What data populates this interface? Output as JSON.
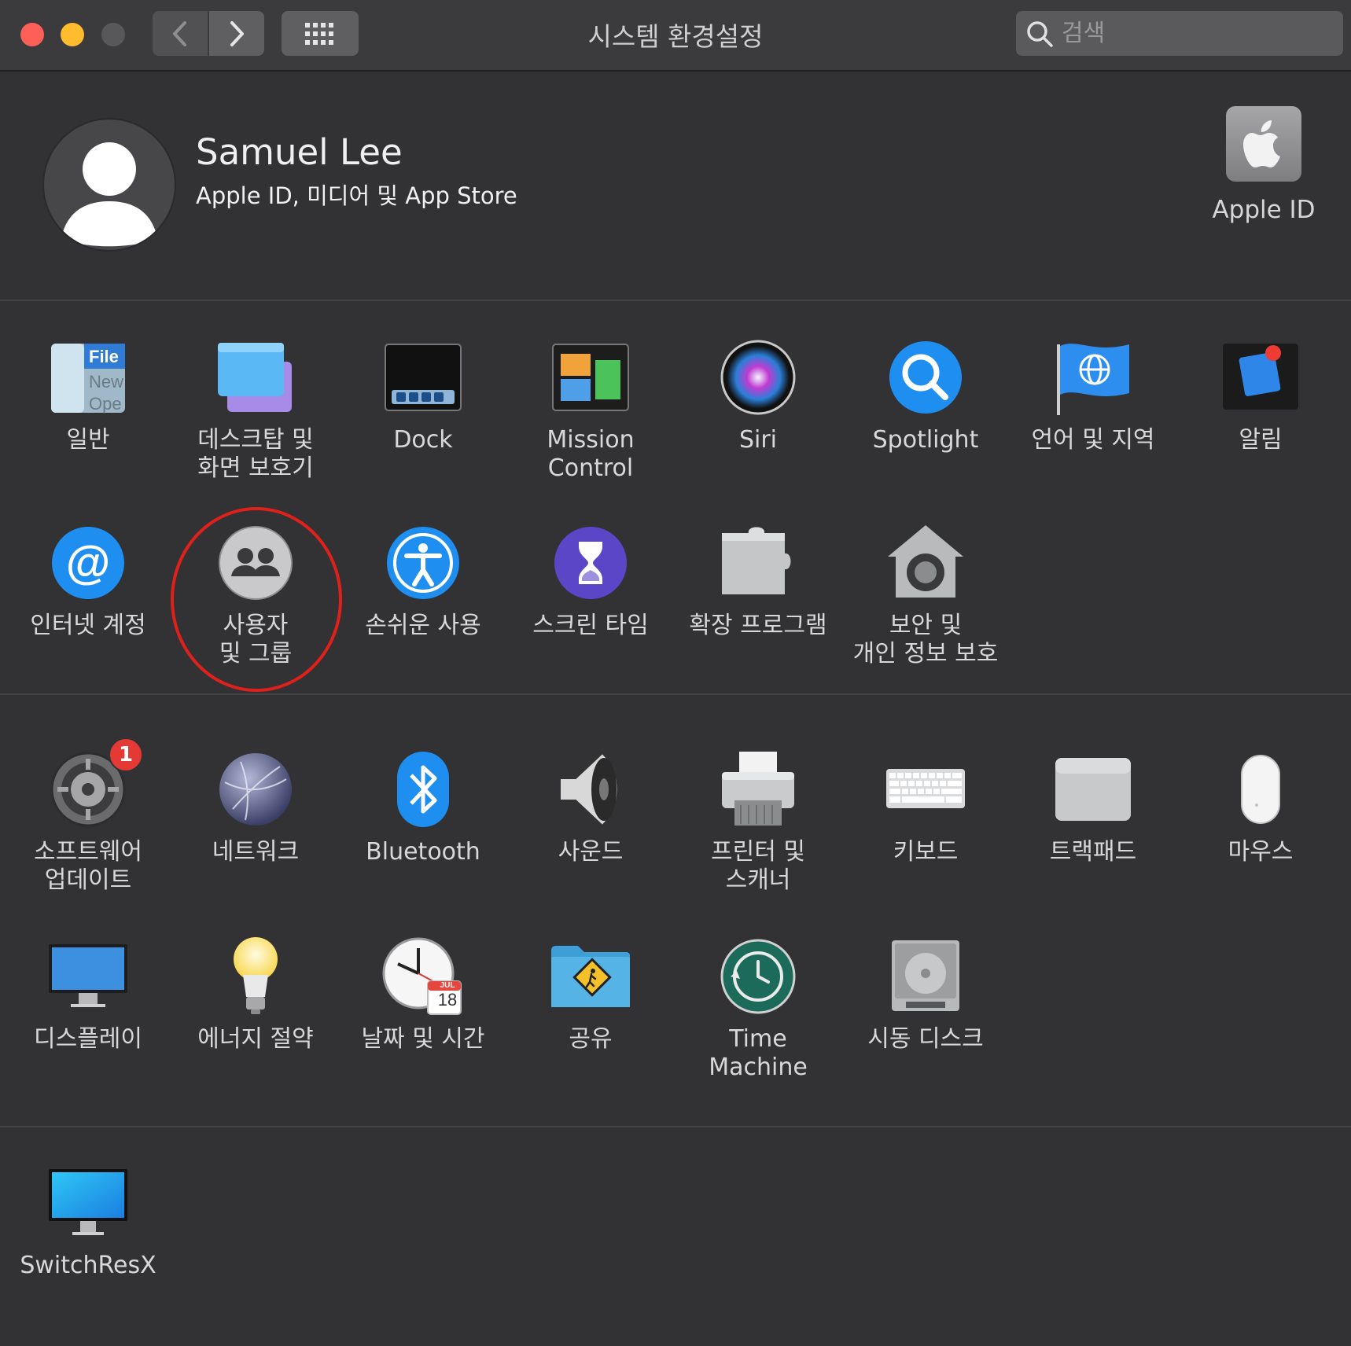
{
  "window": {
    "title": "시스템 환경설정"
  },
  "search": {
    "placeholder": "검색"
  },
  "account": {
    "name": "Samuel Lee",
    "subtitle": "Apple ID, 미디어 및 App Store",
    "apple_id_label": "Apple ID"
  },
  "sections": {
    "personal": [
      {
        "label": "일반",
        "icon": "general-icon"
      },
      {
        "label": "데스크탑 및\n화면 보호기",
        "icon": "desktop-screensaver-icon"
      },
      {
        "label": "Dock",
        "icon": "dock-icon"
      },
      {
        "label": "Mission\nControl",
        "icon": "mission-control-icon"
      },
      {
        "label": "Siri",
        "icon": "siri-icon"
      },
      {
        "label": "Spotlight",
        "icon": "spotlight-icon"
      },
      {
        "label": "언어 및 지역",
        "icon": "language-region-icon"
      },
      {
        "label": "알림",
        "icon": "notifications-icon"
      },
      {
        "label": "인터넷 계정",
        "icon": "internet-accounts-icon"
      },
      {
        "label": "사용자\n및 그룹",
        "icon": "users-groups-icon"
      },
      {
        "label": "손쉬운 사용",
        "icon": "accessibility-icon"
      },
      {
        "label": "스크린 타임",
        "icon": "screen-time-icon"
      },
      {
        "label": "확장 프로그램",
        "icon": "extensions-icon"
      },
      {
        "label": "보안 및\n개인 정보 보호",
        "icon": "security-privacy-icon"
      }
    ],
    "hardware": [
      {
        "label": "소프트웨어\n업데이트",
        "icon": "software-update-icon",
        "badge": "1"
      },
      {
        "label": "네트워크",
        "icon": "network-icon"
      },
      {
        "label": "Bluetooth",
        "icon": "bluetooth-icon"
      },
      {
        "label": "사운드",
        "icon": "sound-icon"
      },
      {
        "label": "프린터 및\n스캐너",
        "icon": "printers-scanners-icon"
      },
      {
        "label": "키보드",
        "icon": "keyboard-icon"
      },
      {
        "label": "트랙패드",
        "icon": "trackpad-icon"
      },
      {
        "label": "마우스",
        "icon": "mouse-icon"
      },
      {
        "label": "디스플레이",
        "icon": "displays-icon"
      },
      {
        "label": "에너지 절약",
        "icon": "energy-saver-icon"
      },
      {
        "label": "날짜 및 시간",
        "icon": "date-time-icon",
        "cal_month": "JUL",
        "cal_day": "18"
      },
      {
        "label": "공유",
        "icon": "sharing-icon"
      },
      {
        "label": "Time\nMachine",
        "icon": "time-machine-icon"
      },
      {
        "label": "시동 디스크",
        "icon": "startup-disk-icon"
      }
    ],
    "other": [
      {
        "label": "SwitchResX",
        "icon": "switchresx-icon"
      }
    ]
  },
  "colors": {
    "background": "#323234",
    "highlight_circle": "#e0201a",
    "badge": "#e53935"
  }
}
